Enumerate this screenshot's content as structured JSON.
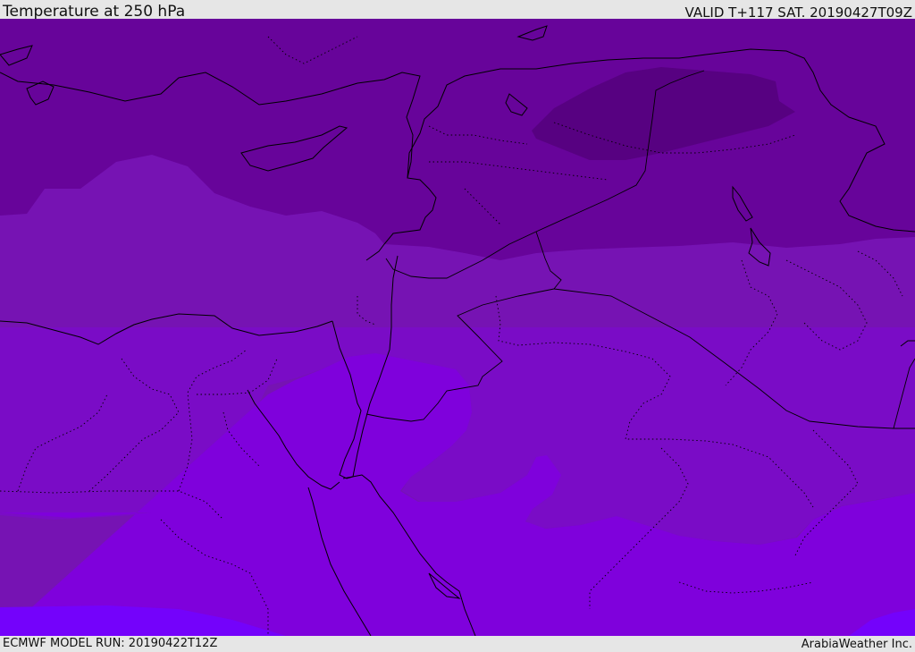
{
  "header": {
    "title": "Temperature at 250 hPa",
    "valid": "VALID T+117 SAT. 20190427T09Z"
  },
  "footer": {
    "model_run": "ECMWF MODEL RUN: 20190422T12Z",
    "credit": "ArabiaWeather Inc."
  },
  "map": {
    "field": "temperature-250hPa",
    "palette": {
      "coldest": "#570181",
      "cold": "#67049a",
      "mid": "#7613b3",
      "mild": "#7a0cc6",
      "warm": "#7f01dc",
      "warmest": "#7402fb"
    },
    "line_color": "#000000"
  }
}
